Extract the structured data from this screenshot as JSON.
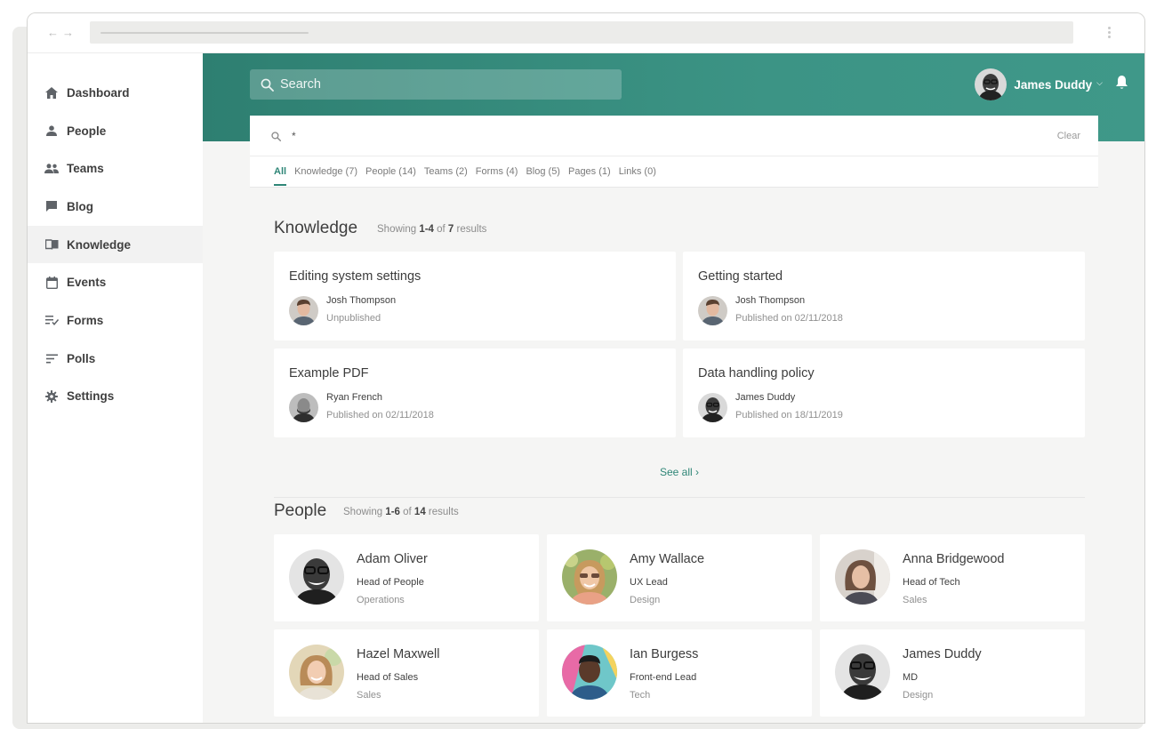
{
  "sidebar": {
    "items": [
      {
        "label": "Dashboard",
        "icon": "home-icon"
      },
      {
        "label": "People",
        "icon": "person-icon"
      },
      {
        "label": "Teams",
        "icon": "group-icon"
      },
      {
        "label": "Blog",
        "icon": "chat-icon"
      },
      {
        "label": "Knowledge",
        "icon": "book-icon"
      },
      {
        "label": "Events",
        "icon": "calendar-icon"
      },
      {
        "label": "Forms",
        "icon": "checklist-icon"
      },
      {
        "label": "Polls",
        "icon": "bars-icon"
      },
      {
        "label": "Settings",
        "icon": "gear-icon"
      }
    ],
    "active_index": 4
  },
  "header": {
    "search_label": "Search",
    "user_name": "James Duddy"
  },
  "search_panel": {
    "query": "*",
    "clear_label": "Clear",
    "tabs": [
      "All",
      "Knowledge (7)",
      "People (14)",
      "Teams (2)",
      "Forms (4)",
      "Blog (5)",
      "Pages (1)",
      "Links (0)"
    ]
  },
  "knowledge": {
    "title": "Knowledge",
    "showing_prefix": "Showing ",
    "range": "1-4",
    "of": " of ",
    "total": "7",
    "suffix": " results",
    "cards": [
      {
        "title": "Editing system settings",
        "author": "Josh Thompson",
        "status": "Unpublished"
      },
      {
        "title": "Getting started",
        "author": "Josh Thompson",
        "status": "Published on 02/11/2018"
      },
      {
        "title": "Example PDF",
        "author": "Ryan French",
        "status": "Published on 02/11/2018"
      },
      {
        "title": "Data handling policy",
        "author": "James Duddy",
        "status": "Published on 18/11/2019"
      }
    ],
    "see_all": "See all ›"
  },
  "people": {
    "title": "People",
    "showing_prefix": "Showing ",
    "range": "1-6",
    "of": " of ",
    "total": "14",
    "suffix": " results",
    "cards": [
      {
        "name": "Adam Oliver",
        "role": "Head of People",
        "dept": "Operations"
      },
      {
        "name": "Amy Wallace",
        "role": "UX Lead",
        "dept": "Design"
      },
      {
        "name": "Anna Bridgewood",
        "role": "Head of Tech",
        "dept": "Sales"
      },
      {
        "name": "Hazel Maxwell",
        "role": "Head of Sales",
        "dept": "Sales"
      },
      {
        "name": "Ian Burgess",
        "role": "Front-end Lead",
        "dept": "Tech"
      },
      {
        "name": "James Duddy",
        "role": "MD",
        "dept": "Design"
      }
    ]
  },
  "colors": {
    "accent": "#2f8677",
    "header": "#3c9485"
  }
}
